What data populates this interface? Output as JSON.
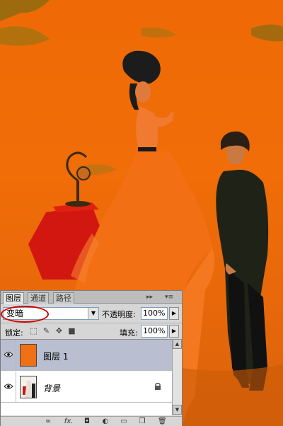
{
  "panel": {
    "tabs": [
      "图层",
      "通道",
      "路径"
    ],
    "tab_menu_glyphs": [
      "▸▸",
      "▾≡"
    ],
    "blend_mode": "变暗",
    "opacity_label": "不透明度:",
    "opacity_value": "100%",
    "lock_label": "锁定:",
    "fill_label": "填充:",
    "fill_value": "100%",
    "layers": [
      {
        "name": "图层 1",
        "selected": true,
        "visible": true
      },
      {
        "name": "背景",
        "selected": false,
        "visible": true,
        "locked": true
      }
    ],
    "footer_icons": [
      "link-icon",
      "fx-icon",
      "mask-icon",
      "adjustment-icon",
      "folder-icon",
      "new-layer-icon",
      "trash-icon"
    ],
    "footer_fx_text": "fx."
  },
  "colors": {
    "tint": "#ef6a06",
    "highlight": "#d10000",
    "selected_row": "#b9bfd0"
  }
}
